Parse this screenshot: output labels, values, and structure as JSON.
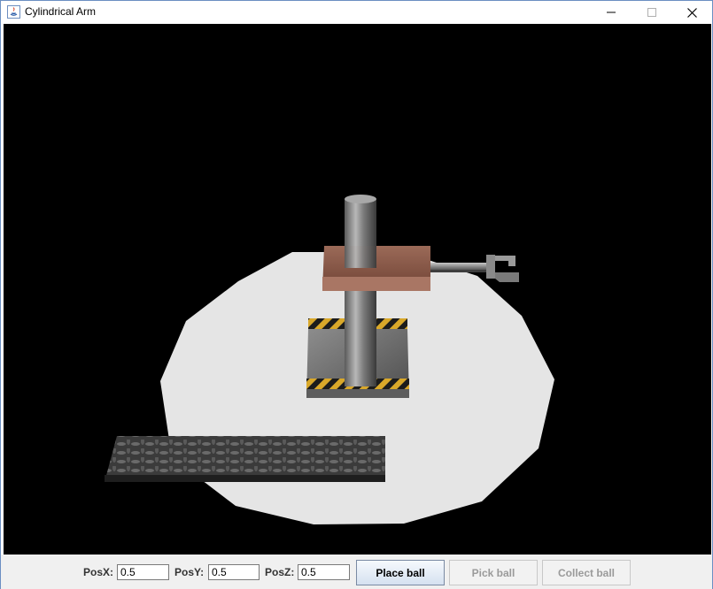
{
  "window": {
    "title": "Cylindrical Arm",
    "app_icon": "java-icon",
    "controls": [
      "minimize-icon",
      "maximize-icon",
      "close-icon"
    ]
  },
  "scene": {
    "description_icons": [
      "robot-arm-3d-view"
    ],
    "background_color": "#000000",
    "floor_color": "#e5e5e5"
  },
  "controls": {
    "posx_label": "PosX:",
    "posx_value": "0.5",
    "posy_label": "PosY:",
    "posy_value": "0.5",
    "posz_label": "PosZ:",
    "posz_value": "0.5",
    "place_ball_label": "Place ball",
    "pick_ball_label": "Pick ball",
    "collect_ball_label": "Collect ball"
  }
}
